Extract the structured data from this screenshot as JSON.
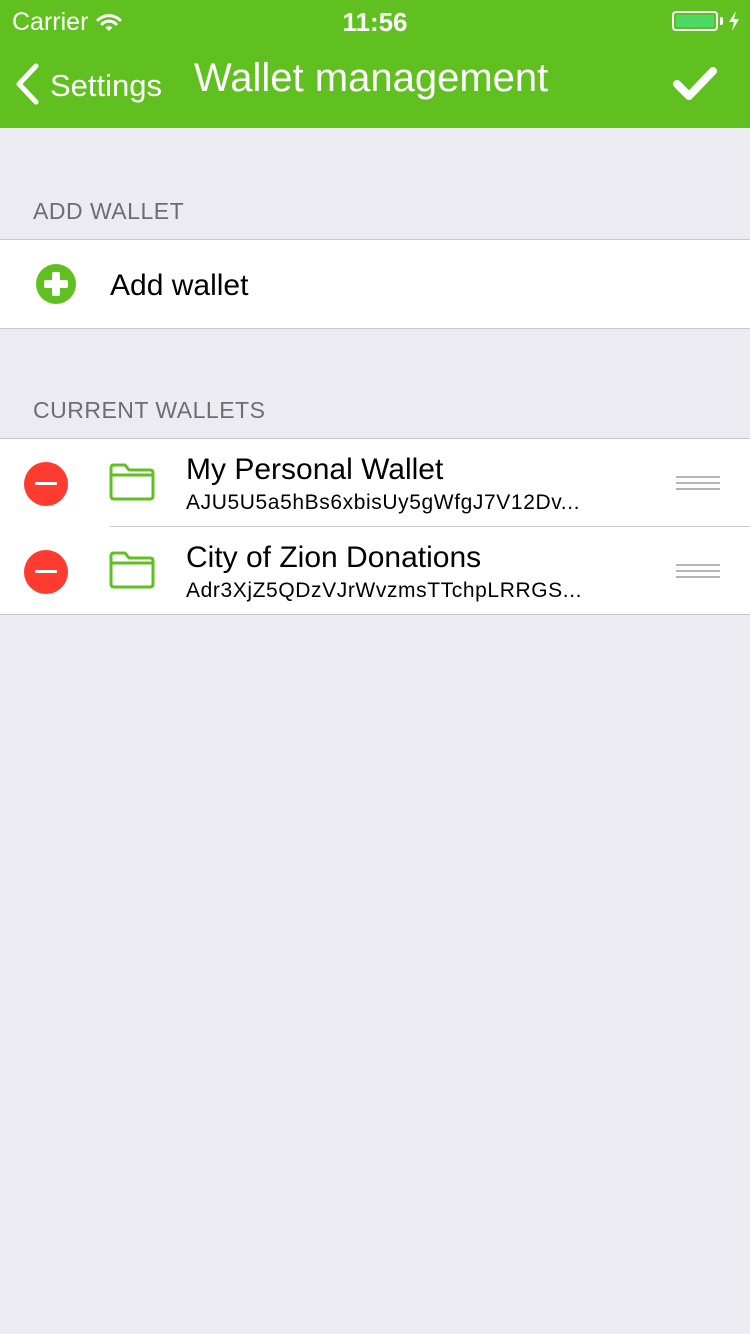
{
  "status_bar": {
    "carrier": "Carrier",
    "time": "11:56"
  },
  "nav": {
    "back_label": "Settings",
    "title": "Wallet management",
    "done_icon": "checkmark-icon"
  },
  "sections": {
    "add_wallet_header": "ADD WALLET",
    "add_wallet_label": "Add wallet",
    "current_wallets_header": "CURRENT WALLETS"
  },
  "wallets": [
    {
      "name": "My Personal Wallet",
      "address": "AJU5U5a5hBs6xbisUy5gWfgJ7V12Dv..."
    },
    {
      "name": "City of Zion Donations",
      "address": "Adr3XjZ5QDzVJrWvzmsTTchpLRRGS..."
    }
  ],
  "colors": {
    "brand_green": "#60c020",
    "delete_red": "#ff3b30",
    "background": "#ebebf1",
    "battery_green": "#4cd964"
  }
}
